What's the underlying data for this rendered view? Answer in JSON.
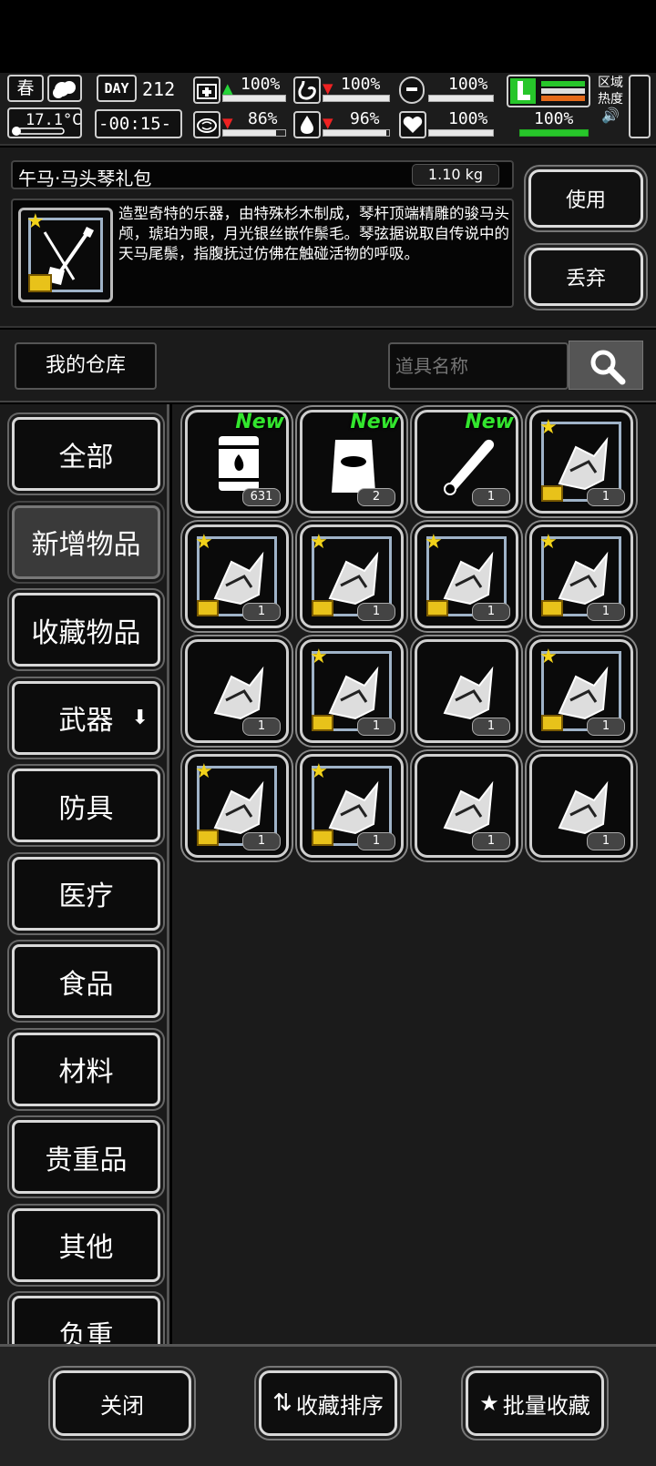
{
  "status": {
    "season": "春",
    "day_label": "DAY",
    "day": "212",
    "temperature": "17.1°C",
    "clock": "-00:15-",
    "stats": [
      {
        "name": "health",
        "value": "100%",
        "trend": "up",
        "level": 1.0
      },
      {
        "name": "hunger",
        "value": "100%",
        "trend": "down",
        "level": 1.0
      },
      {
        "name": "stamina",
        "value": "100%",
        "trend": "none",
        "level": 1.0
      },
      {
        "name": "brain",
        "value": "86%",
        "trend": "down",
        "level": 0.86
      },
      {
        "name": "thirst",
        "value": "96%",
        "trend": "down",
        "level": 0.96
      },
      {
        "name": "mood",
        "value": "100%",
        "trend": "none",
        "level": 1.0
      }
    ],
    "leg_value": "100%",
    "zone_label": "区域热度"
  },
  "item": {
    "name": "午马·马头琴礼包",
    "weight": "1.10 kg",
    "description": "造型奇特的乐器，由特殊杉木制成，琴杆顶端精雕的骏马头颅，琥珀为眼，月光银丝嵌作鬃毛。琴弦据说取自传说中的天马尾鬃，指腹抚过仿佛在触碰活物的呼吸。",
    "use_label": "使用",
    "discard_label": "丢弃"
  },
  "warehouse": {
    "title": "我的仓库",
    "search_placeholder": "道具名称"
  },
  "categories": [
    {
      "label": "全部",
      "active": false
    },
    {
      "label": "新增物品",
      "active": true
    },
    {
      "label": "收藏物品",
      "active": false
    },
    {
      "label": "武器",
      "active": false,
      "has_arrow": true
    },
    {
      "label": "防具",
      "active": false
    },
    {
      "label": "医疗",
      "active": false
    },
    {
      "label": "食品",
      "active": false
    },
    {
      "label": "材料",
      "active": false
    },
    {
      "label": "贵重品",
      "active": false
    },
    {
      "label": "其他",
      "active": false
    },
    {
      "label": "负重",
      "active": false
    }
  ],
  "items": [
    {
      "icon": "barrel-icon",
      "count": "631",
      "new": "New",
      "gift": false
    },
    {
      "icon": "sack-icon",
      "count": "2",
      "new": "New",
      "gift": false
    },
    {
      "icon": "chainsaw-bar-icon",
      "count": "1",
      "new": "New",
      "gift": false
    },
    {
      "icon": "rifle-gift-icon",
      "count": "1",
      "new": "",
      "gift": true
    },
    {
      "icon": "gloves-gift-icon",
      "count": "1",
      "new": "",
      "gift": true
    },
    {
      "icon": "chainsaw-gift-icon",
      "count": "1",
      "new": "",
      "gift": true
    },
    {
      "icon": "armor-gift-icon",
      "count": "1",
      "new": "",
      "gift": true
    },
    {
      "icon": "vest-gift-icon",
      "count": "1",
      "new": "",
      "gift": true
    },
    {
      "icon": "mechanical-part-icon",
      "count": "1",
      "new": "",
      "gift": false
    },
    {
      "icon": "backpack-gift-icon",
      "count": "1",
      "new": "",
      "gift": true
    },
    {
      "icon": "armor-piece-icon",
      "count": "1",
      "new": "",
      "gift": false
    },
    {
      "icon": "horsehead-fiddle-gift-icon",
      "count": "1",
      "new": "",
      "gift": true
    },
    {
      "icon": "whip-gift-icon",
      "count": "1",
      "new": "",
      "gift": true
    },
    {
      "icon": "emblem-gift-icon",
      "count": "1",
      "new": "",
      "gift": true
    },
    {
      "icon": "car-body-icon",
      "count": "1",
      "new": "",
      "gift": false
    },
    {
      "icon": "engine-icon",
      "count": "1",
      "new": "",
      "gift": false
    }
  ],
  "bottom": {
    "close_label": "关闭",
    "sort_label": "收藏排序",
    "batch_label": "批量收藏"
  }
}
